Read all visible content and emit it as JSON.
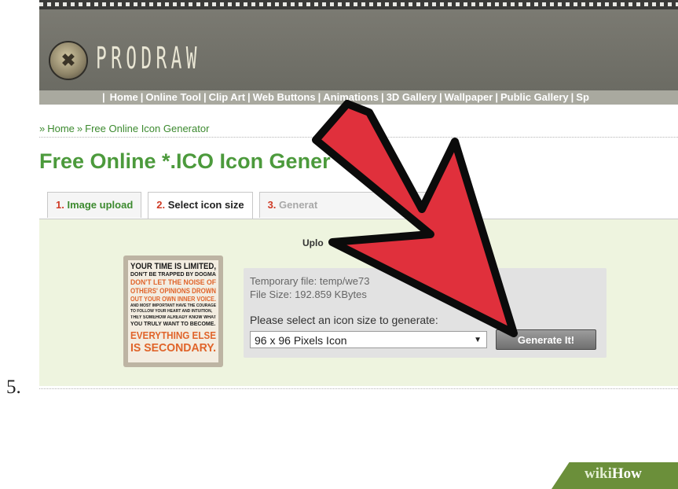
{
  "step_number": "5.",
  "site": {
    "logo_text": "PRODRAW",
    "nav": [
      "Home",
      "Online Tool",
      "Clip Art",
      "Web Buttons",
      "Animations",
      "3D Gallery",
      "Wallpaper",
      "Public Gallery",
      "Sp"
    ]
  },
  "breadcrumb": {
    "home": "Home",
    "current": "Free Online Icon Generator"
  },
  "page_title": "Free Online *.ICO Icon Gener",
  "tabs": [
    {
      "number": "1.",
      "label": "Image upload"
    },
    {
      "number": "2.",
      "label": "Select icon size"
    },
    {
      "number": "3.",
      "label": "Generat"
    }
  ],
  "panel": {
    "upload_label": "Uplo",
    "temp_file": "Temporary file: temp/we73",
    "file_size": "File Size: 192.859 KBytes",
    "select_label": "Please select an icon size to generate:",
    "select_value": "96 x 96 Pixels Icon",
    "generate_button": "Generate It!"
  },
  "thumbnail_text": [
    "YOUR TIME IS LIMITED,",
    "DON'T BE TRAPPED BY DOGMA",
    "DON'T LET THE NOISE OF",
    "OTHERS' OPINIONS DROWN",
    "OUT YOUR OWN INNER VOICE.",
    "AND MOST IMPORTANT HAVE THE COURAGE",
    "TO FOLLOW YOUR HEART AND INTUITION,",
    "THEY SOMEHOW ALREADY KNOW WHAT",
    "YOU TRULY WANT TO BECOME.",
    "EVERYTHING ELSE",
    "IS SECONDARY."
  ],
  "watermark": {
    "wiki": "wiki",
    "how": "How"
  },
  "colors": {
    "arrow": "#e0303c",
    "green_accent": "#4c9a3c",
    "link": "#3c8a2f",
    "number_red": "#cf3a25"
  }
}
